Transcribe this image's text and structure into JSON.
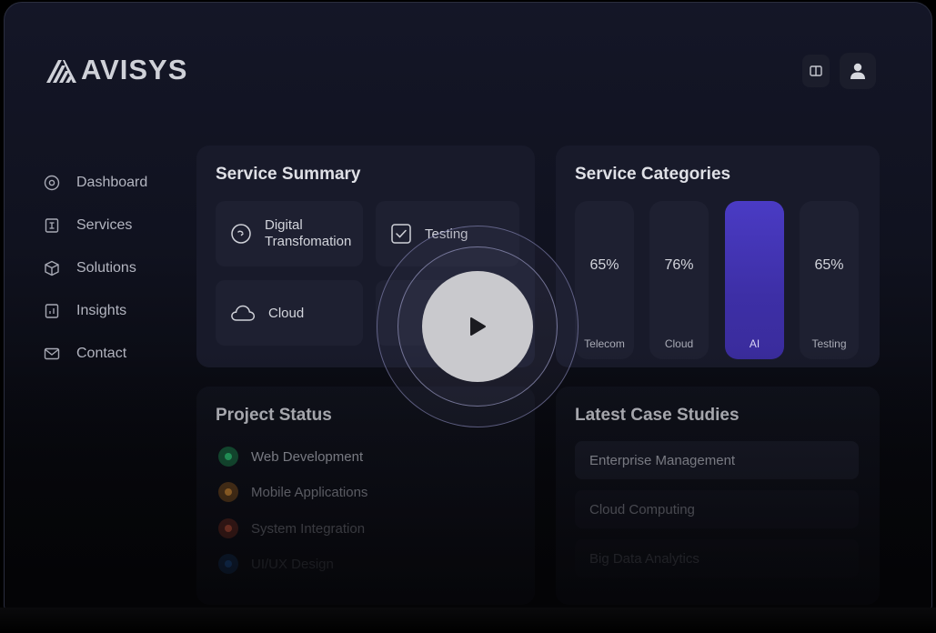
{
  "brand": {
    "name": "AVISYS"
  },
  "header": {
    "panel_icon": "panel-icon",
    "user_icon": "user-icon"
  },
  "sidebar": {
    "items": [
      {
        "label": "Dashboard",
        "icon": "target-icon"
      },
      {
        "label": "Services",
        "icon": "document-icon"
      },
      {
        "label": "Solutions",
        "icon": "cube-icon"
      },
      {
        "label": "Insights",
        "icon": "chart-icon"
      },
      {
        "label": "Contact",
        "icon": "mail-icon"
      }
    ]
  },
  "service_summary": {
    "title": "Service Summary",
    "tiles": [
      {
        "label": "Digital Transfomation",
        "line1": "Digital",
        "line2": "Transfomation",
        "icon": "gauge-icon"
      },
      {
        "label": "Testing",
        "icon": "check-icon"
      },
      {
        "label": "Cloud",
        "icon": "cloud-icon"
      },
      {
        "label": "",
        "icon": ""
      }
    ]
  },
  "service_categories": {
    "title": "Service Categories",
    "bars": [
      {
        "label": "Telecom",
        "percent": "65%",
        "active": false
      },
      {
        "label": "Cloud",
        "percent": "76%",
        "active": false
      },
      {
        "label": "AI",
        "percent": "",
        "active": true
      },
      {
        "label": "Testing",
        "percent": "65%",
        "active": false
      }
    ]
  },
  "project_status": {
    "title": "Project Status",
    "items": [
      {
        "label": "Web Development",
        "color": "#1f9a57"
      },
      {
        "label": "Mobile Applications",
        "color": "#c77a24"
      },
      {
        "label": "System Integration",
        "color": "#c2452e"
      },
      {
        "label": "UI/UX Design",
        "color": "#1c5fb0"
      }
    ]
  },
  "case_studies": {
    "title": "Latest Case Studies",
    "items": [
      {
        "label": "Enterprise Management"
      },
      {
        "label": "Cloud Computing"
      },
      {
        "label": "Big Data Analytics"
      }
    ]
  },
  "video": {
    "play_icon": "play-icon"
  }
}
